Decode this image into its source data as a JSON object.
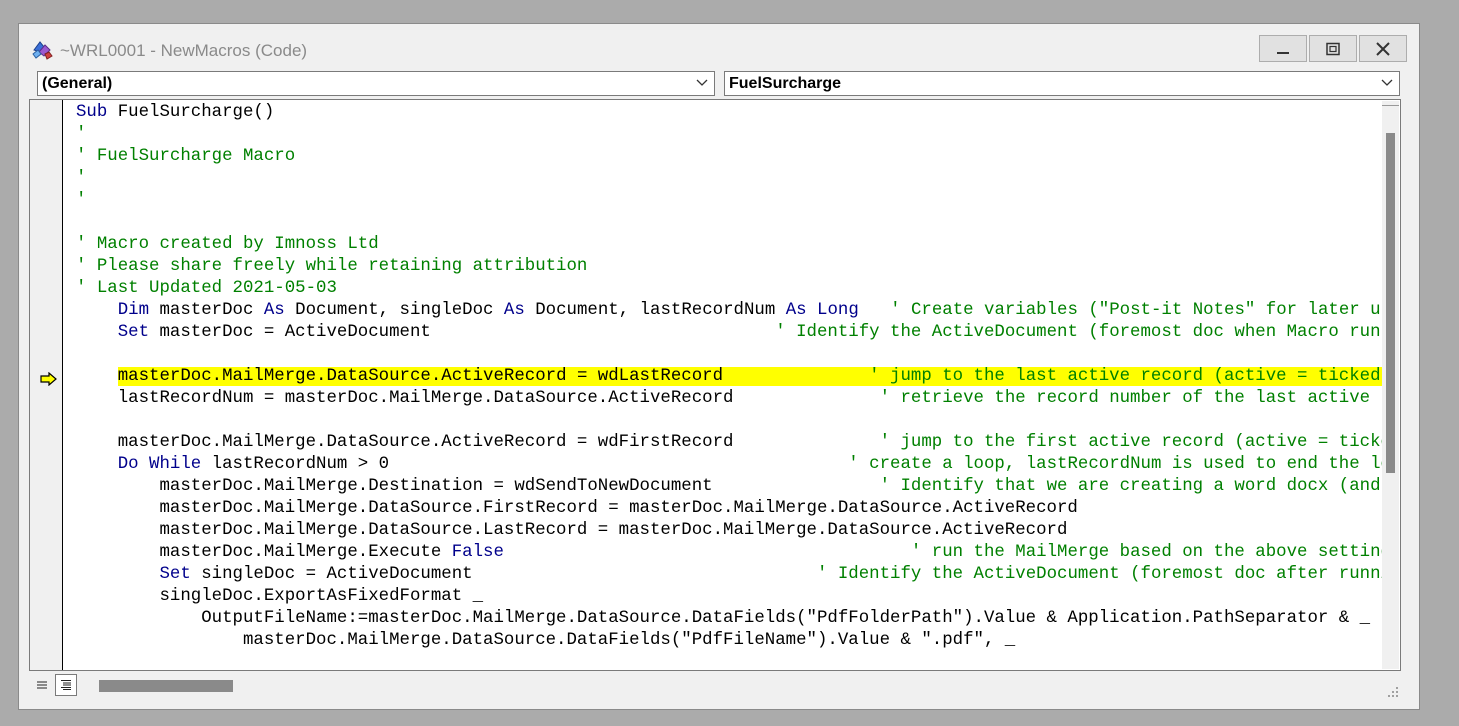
{
  "window": {
    "title": "~WRL0001 - NewMacros (Code)",
    "buttons": [
      "minimize",
      "maximize",
      "close"
    ]
  },
  "object_combo": {
    "value": "(General)"
  },
  "procedure_combo": {
    "value": "FuelSurcharge"
  },
  "colors": {
    "keyword": "#00008b",
    "comment": "#008000",
    "highlight": "#ffff00",
    "exec_arrow": "#ffff00"
  },
  "code_lines": [
    {
      "segments": [
        {
          "t": "Sub",
          "c": "kw"
        },
        {
          "t": " FuelSurcharge()"
        }
      ]
    },
    {
      "segments": [
        {
          "t": "'",
          "c": "cm"
        }
      ]
    },
    {
      "segments": [
        {
          "t": "' FuelSurcharge Macro",
          "c": "cm"
        }
      ]
    },
    {
      "segments": [
        {
          "t": "'",
          "c": "cm"
        }
      ]
    },
    {
      "segments": [
        {
          "t": "'",
          "c": "cm"
        }
      ]
    },
    {
      "segments": []
    },
    {
      "segments": [
        {
          "t": "' Macro created by Imnoss Ltd",
          "c": "cm"
        }
      ]
    },
    {
      "segments": [
        {
          "t": "' Please share freely while retaining attribution",
          "c": "cm"
        }
      ]
    },
    {
      "segments": [
        {
          "t": "' Last Updated 2021-05-03",
          "c": "cm"
        }
      ]
    },
    {
      "segments": [
        {
          "t": "    "
        },
        {
          "t": "Dim",
          "c": "kw"
        },
        {
          "t": " masterDoc "
        },
        {
          "t": "As",
          "c": "kw"
        },
        {
          "t": " Document, singleDoc "
        },
        {
          "t": "As",
          "c": "kw"
        },
        {
          "t": " Document, lastRecordNum "
        },
        {
          "t": "As",
          "c": "kw"
        },
        {
          "t": " "
        },
        {
          "t": "Long",
          "c": "kw"
        },
        {
          "t": "   "
        },
        {
          "t": "' Create variables (\"Post-it Notes\" for later use)",
          "c": "cm"
        }
      ]
    },
    {
      "segments": [
        {
          "t": "    "
        },
        {
          "t": "Set",
          "c": "kw"
        },
        {
          "t": " masterDoc = ActiveDocument                                 "
        },
        {
          "t": "' Identify the ActiveDocument (foremost doc when Macro run) as \"masterDoc\"",
          "c": "cm"
        }
      ]
    },
    {
      "segments": []
    },
    {
      "segments": [
        {
          "t": "    "
        },
        {
          "t": "masterDoc.MailMerge.DataSource.ActiveRecord = wdLastRecord              ",
          "c": "hl"
        },
        {
          "t": "' jump to the last active record (active = ticked in edit recipients)",
          "c": "cm hl"
        }
      ]
    },
    {
      "segments": [
        {
          "t": "    lastRecordNum = masterDoc.MailMerge.DataSource.ActiveRecord              "
        },
        {
          "t": "' retrieve the record number of the last active record so we know when to stop",
          "c": "cm"
        }
      ]
    },
    {
      "segments": []
    },
    {
      "segments": [
        {
          "t": "    masterDoc.MailMerge.DataSource.ActiveRecord = wdFirstRecord              "
        },
        {
          "t": "' jump to the first active record (active = ticked in edit recipients)",
          "c": "cm"
        }
      ]
    },
    {
      "segments": [
        {
          "t": "    "
        },
        {
          "t": "Do While",
          "c": "kw"
        },
        {
          "t": " lastRecordNum > 0                                            "
        },
        {
          "t": "' create a loop, lastRecordNum is used to end the loop by setting to zero (see below)",
          "c": "cm"
        }
      ]
    },
    {
      "segments": [
        {
          "t": "        masterDoc.MailMerge.Destination = wdSendToNewDocument                "
        },
        {
          "t": "' Identify that we are creating a word docx (and no e.g. an email)",
          "c": "cm"
        }
      ]
    },
    {
      "segments": [
        {
          "t": "        masterDoc.MailMerge.DataSource.FirstRecord = masterDoc.MailMerge.DataSource.ActiveRecord"
        }
      ]
    },
    {
      "segments": [
        {
          "t": "        masterDoc.MailMerge.DataSource.LastRecord = masterDoc.MailMerge.DataSource.ActiveRecord"
        }
      ]
    },
    {
      "segments": [
        {
          "t": "        masterDoc.MailMerge.Execute "
        },
        {
          "t": "False",
          "c": "kw"
        },
        {
          "t": "                                       "
        },
        {
          "t": "' run the MailMerge based on the above settings",
          "c": "cm"
        }
      ]
    },
    {
      "segments": [
        {
          "t": "        "
        },
        {
          "t": "Set",
          "c": "kw"
        },
        {
          "t": " singleDoc = ActiveDocument                                 "
        },
        {
          "t": "' Identify the ActiveDocument (foremost doc after running the MailMerge) as \"singleDoc\"",
          "c": "cm"
        }
      ]
    },
    {
      "segments": [
        {
          "t": "        singleDoc.ExportAsFixedFormat _"
        }
      ]
    },
    {
      "segments": [
        {
          "t": "            OutputFileName:=masterDoc.MailMerge.DataSource.DataFields(\"PdfFolderPath\").Value & Application.PathSeparator & _"
        }
      ]
    },
    {
      "segments": [
        {
          "t": "                masterDoc.MailMerge.DataSource.DataFields(\"PdfFileName\").Value & \".pdf\", _"
        }
      ]
    }
  ],
  "view_buttons": [
    "procedure-view",
    "full-module-view"
  ]
}
